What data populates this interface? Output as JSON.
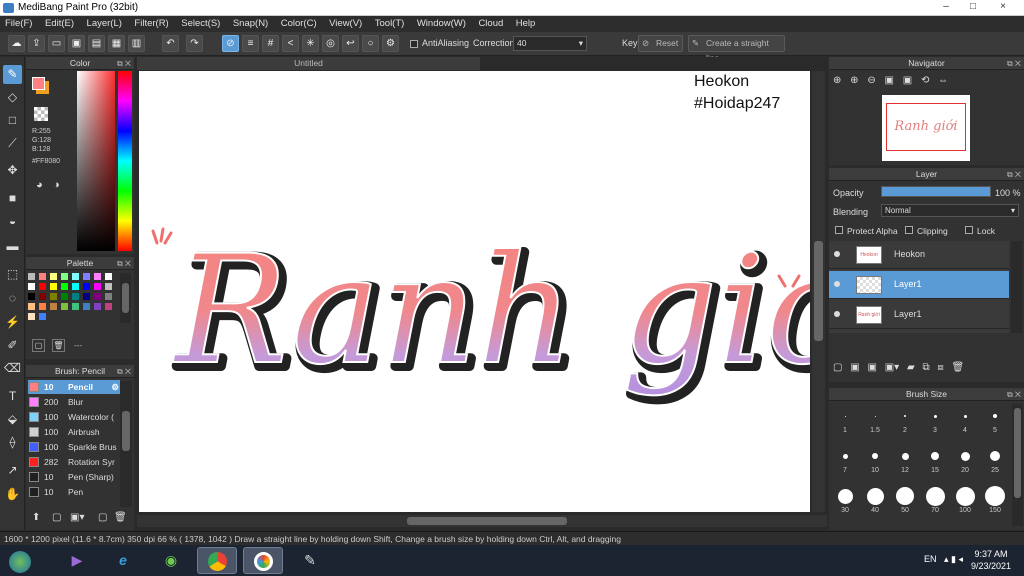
{
  "window": {
    "title": "MediBang Paint Pro (32bit)",
    "minimize": "–",
    "maximize": "□",
    "close": "×"
  },
  "menu": [
    "File(F)",
    "Edit(E)",
    "Layer(L)",
    "Filter(R)",
    "Select(S)",
    "Snap(N)",
    "Color(C)",
    "View(V)",
    "Tool(T)",
    "Window(W)",
    "Cloud",
    "Help"
  ],
  "toolbar": {
    "antialiasing_label": "AntiAliasing",
    "correction_label": "Correction",
    "correction_value": "40",
    "key_label": "Key",
    "reset_label": "Reset",
    "straight_line_label": "Create a straight line"
  },
  "color_panel": {
    "title": "Color",
    "r": "R:255",
    "g": "G:128",
    "b": "B:128",
    "hex": "#FF8080",
    "primary": "#ff8080",
    "secondary": "#f0a020"
  },
  "palette_panel": {
    "title": "Palette",
    "dash": "---"
  },
  "brush_panel": {
    "title": "Brush: Pencil",
    "brushes": [
      {
        "size": "10",
        "name": "Pencil",
        "color": "#ff8080",
        "selected": true
      },
      {
        "size": "200",
        "name": "Blur",
        "color": "#ff80ff"
      },
      {
        "size": "100",
        "name": "Watercolor (",
        "color": "#80d0ff"
      },
      {
        "size": "100",
        "name": "Airbrush",
        "color": "#d0d0d0"
      },
      {
        "size": "100",
        "name": "Sparkle Brus",
        "color": "#4060ff"
      },
      {
        "size": "282",
        "name": "Rotation Syr",
        "color": "#ff2020"
      },
      {
        "size": "10",
        "name": "Pen (Sharp)",
        "color": "#202020"
      },
      {
        "size": "10",
        "name": "Pen",
        "color": "#202020"
      }
    ]
  },
  "canvas": {
    "tab_title": "Untitled",
    "artwork_text": "Ranh giới",
    "watermark_line1": "Heokon",
    "watermark_line2": "#Hoidap247"
  },
  "navigator": {
    "title": "Navigator",
    "preview_text": "Ranh giới"
  },
  "layer_panel": {
    "title": "Layer",
    "opacity_label": "Opacity",
    "opacity_value": "100 %",
    "opacity_fraction": 1.0,
    "blending_label": "Blending",
    "blending_value": "Normal",
    "protect_alpha": "Protect Alpha",
    "clipping": "Clipping",
    "lock": "Lock",
    "layers": [
      {
        "name": "Heokon",
        "thumb": "Heokon #Hoidap247",
        "selected": false
      },
      {
        "name": "Layer1",
        "thumb": "",
        "selected": true
      },
      {
        "name": "Layer1",
        "thumb": "Ranh giới",
        "selected": false
      }
    ]
  },
  "brush_size_panel": {
    "title": "Brush Size",
    "sizes": [
      "1",
      "1.5",
      "2",
      "3",
      "4",
      "5",
      "7",
      "10",
      "12",
      "15",
      "20",
      "25",
      "30",
      "40",
      "50",
      "70",
      "100",
      "150"
    ]
  },
  "status": "1600 * 1200 pixel   (11.6 * 8.7cm)   350 dpi   66 %   ( 1378, 1042 )   Draw a straight line by holding down Shift, Change a brush size by holding down Ctrl, Alt, and dragging",
  "taskbar": {
    "lang": "EN",
    "time": "9:37 AM",
    "date": "9/23/2021"
  }
}
